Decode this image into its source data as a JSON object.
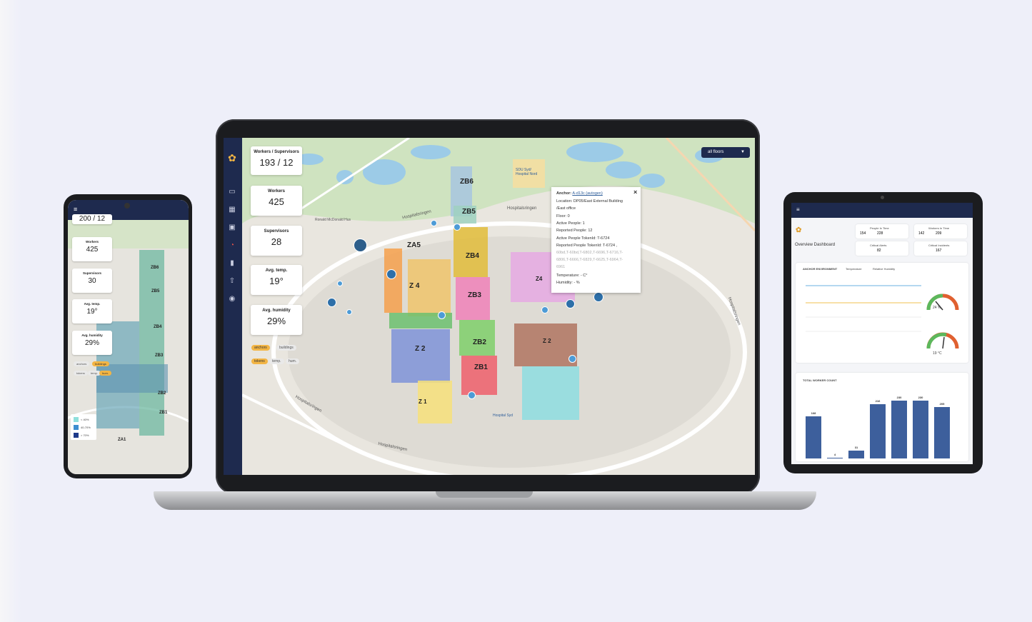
{
  "laptop": {
    "floor_select": "all floors",
    "stats": [
      {
        "label": "Workers / Supervisors",
        "value": "193 / 12"
      },
      {
        "label": "Workers",
        "value": "425"
      },
      {
        "label": "Supervisors",
        "value": "28"
      },
      {
        "label": "Avg. temp.",
        "value": "19°"
      },
      {
        "label": "Avg. humidity",
        "value": "29%"
      }
    ],
    "chips_row1": [
      "anchors",
      "buildings"
    ],
    "chips_row2": [
      "tokens",
      "temp.",
      "hum."
    ],
    "zones": [
      "ZB6",
      "ZB5",
      "ZB4",
      "ZB3",
      "ZB2",
      "ZB1",
      "ZA5",
      "Z 4",
      "Z 2",
      "Z 1",
      "Z4",
      "Z 2"
    ],
    "map_labels": {
      "hospital_north": "SDU Syd/ Hospital Nord",
      "hospital_south": "Hospital Syd",
      "ronald": "Ronald McDonald Hus",
      "road1": "Hospitalsringen",
      "road2": "Hospitalsringen",
      "road3": "Hospitalsringen",
      "road4": "Hospitalsringen",
      "road5": "Hospitalsringen"
    },
    "tooltip": {
      "anchor_label": "Anchor:",
      "anchor_value": "A-d13c (autogen)",
      "location": "Location: DP05/East External Building",
      "location2": "/East office",
      "floor": "Floor: 0",
      "active_people": "Active People: 1",
      "reported_people": "Reported People: 12",
      "active_tokenid": "Active People TokenId: T-6724",
      "reported_tokenid": "Reported People TokenId: T-6724 ,",
      "tokens_line1": "60bd,T-60bd,T-6802,T-6696,T-6716,T-",
      "tokens_line2": "6806,T-6666,T-6829,T-6625,T-6964,T-",
      "tokens_line3": "6961",
      "temperature": "Temperature: - C°",
      "humidity": "Humidity: - %"
    }
  },
  "phone": {
    "top_value": "200 / 12",
    "stats": [
      {
        "label": "Workers",
        "value": "425"
      },
      {
        "label": "Supervisors",
        "value": "30"
      },
      {
        "label": "Avg. temp.",
        "value": "19°"
      },
      {
        "label": "Avg. humidity",
        "value": "29%"
      }
    ],
    "chips_row1": [
      "anchors",
      "buildings"
    ],
    "chips_row2": [
      "tokens",
      "temp.",
      "hum."
    ],
    "zones": [
      "ZB6",
      "ZB5",
      "ZB4",
      "ZB3",
      "ZB2",
      "ZB1",
      "ZA1"
    ],
    "legend": [
      "< 40%",
      "40-70%",
      "> 70%"
    ]
  },
  "tablet": {
    "title": "Overview Dashboard",
    "kpis": [
      {
        "label": "People In Time",
        "values": [
          "154",
          "228"
        ]
      },
      {
        "label": "Workers In Time",
        "values": [
          "142",
          "209"
        ]
      },
      {
        "label": "Critical Alerts",
        "values": [
          "82"
        ]
      },
      {
        "label": "Critical Incidents",
        "values": [
          "167"
        ]
      }
    ],
    "env_panel_title": "ANCHOR ENVIRONMENT",
    "env_tabs": [
      "Temperature",
      "Relative Humidity"
    ],
    "gauge1_value": "24 %",
    "gauge2_value": "19 °C",
    "worker_panel_title": "TOTAL WORKER COUNT",
    "bar_values": [
      168,
      4,
      31,
      216,
      230,
      230,
      205
    ],
    "bar_max": 250
  }
}
